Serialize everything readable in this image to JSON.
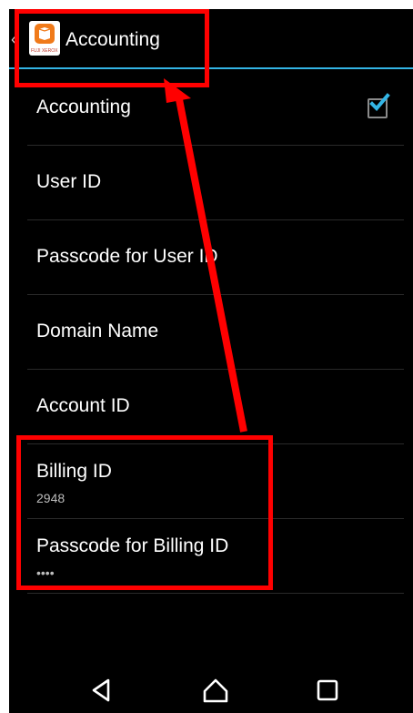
{
  "header": {
    "title": "Accounting",
    "app_icon_caption": "FUJI XEROX"
  },
  "settings": [
    {
      "title": "Accounting",
      "summary": "",
      "checked": true
    },
    {
      "title": "User ID",
      "summary": ""
    },
    {
      "title": "Passcode for User ID",
      "summary": ""
    },
    {
      "title": "Domain Name",
      "summary": ""
    },
    {
      "title": "Account ID",
      "summary": ""
    },
    {
      "title": "Billing ID",
      "summary": "2948"
    },
    {
      "title": "Passcode for Billing ID",
      "summary": "••••"
    }
  ],
  "colors": {
    "accent": "#33b5e5",
    "annotation": "#ff0000",
    "background": "#000000"
  }
}
